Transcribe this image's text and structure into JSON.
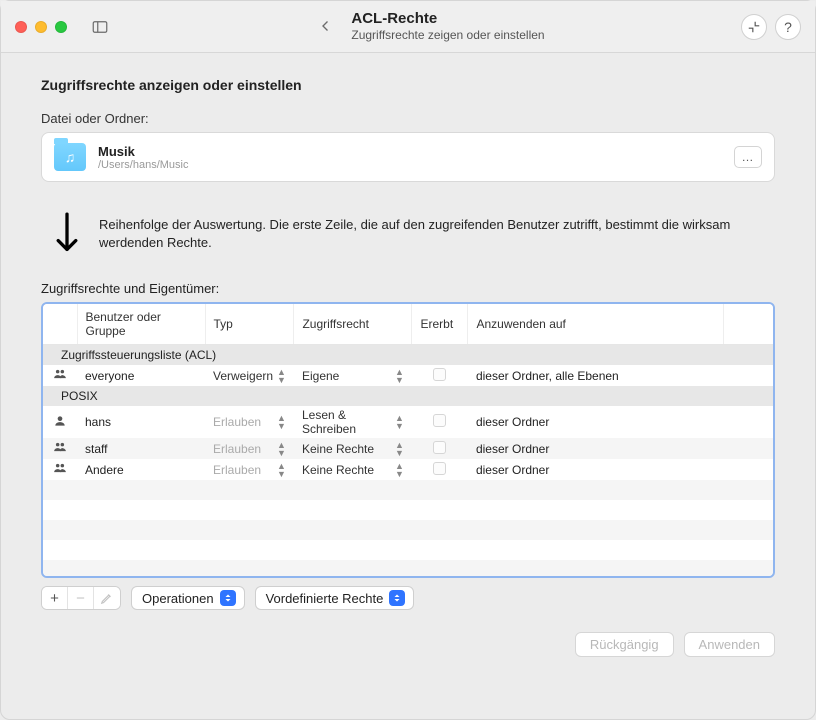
{
  "titlebar": {
    "title": "ACL-Rechte",
    "subtitle": "Zugriffsrechte zeigen oder einstellen"
  },
  "page": {
    "heading": "Zugriffsrechte anzeigen oder einstellen",
    "file_label": "Datei oder Ordner:",
    "file": {
      "name": "Musik",
      "path": "/Users/hans/Music",
      "more": "…"
    },
    "info_text": "Reihenfolge der Auswertung. Die erste Zeile, die auf den zugreifenden Benutzer zutrifft, bestimmt die wirksam werdenden Rechte.",
    "section_label": "Zugriffsrechte und Eigentümer:"
  },
  "table": {
    "headers": {
      "user": "Benutzer oder Gruppe",
      "typ": "Typ",
      "recht": "Zugriffsrecht",
      "ererbt": "Ererbt",
      "apply": "Anzuwenden auf"
    },
    "groups": {
      "acl": "Zugriffssteuerungsliste (ACL)",
      "posix": "POSIX"
    },
    "rows": {
      "r0": {
        "icon": "group",
        "user": "everyone",
        "typ": "Verweigern",
        "typ_dim": false,
        "recht": "Eigene",
        "apply": "dieser Ordner, alle Ebenen"
      },
      "r1": {
        "icon": "person",
        "user": "hans",
        "typ": "Erlauben",
        "typ_dim": true,
        "recht": "Lesen & Schreiben",
        "apply": "dieser Ordner"
      },
      "r2": {
        "icon": "group",
        "user": "staff",
        "typ": "Erlauben",
        "typ_dim": true,
        "recht": "Keine Rechte",
        "apply": "dieser Ordner"
      },
      "r3": {
        "icon": "group",
        "user": "Andere",
        "typ": "Erlauben",
        "typ_dim": true,
        "recht": "Keine Rechte",
        "apply": "dieser Ordner"
      }
    }
  },
  "controls": {
    "add": "+",
    "remove": "−",
    "ops": "Operationen",
    "preset": "Vordefinierte Rechte"
  },
  "footer": {
    "undo": "Rückgängig",
    "apply": "Anwenden"
  }
}
